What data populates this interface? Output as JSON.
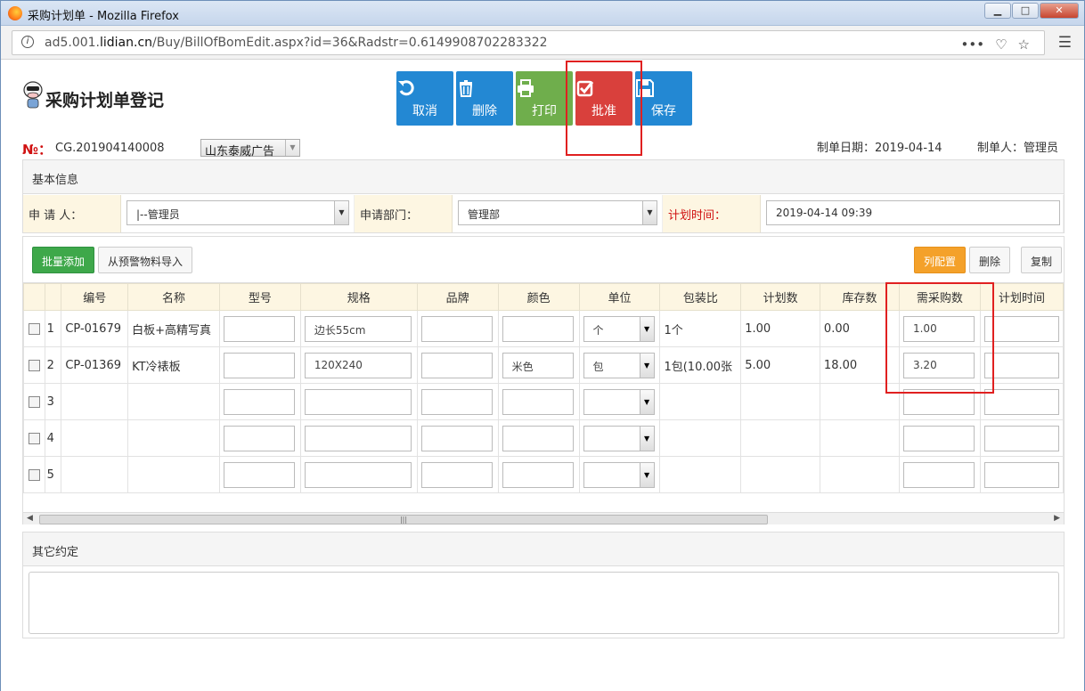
{
  "window": {
    "title": "采购计划单 - Mozilla Firefox",
    "min": "▁",
    "max": "□",
    "close": "✕"
  },
  "browser": {
    "url_host": "ad5.001.lidian.cn",
    "url_path": "/Buy/BillOfBomEdit.aspx?id=36&Radstr=0.6149908702283322",
    "url_prefix": "ad5.001."
  },
  "page": {
    "title": "采购计划单登记"
  },
  "toolbar": [
    {
      "label": "取消",
      "icon": "undo-icon",
      "color": "#2388d3"
    },
    {
      "label": "删除",
      "icon": "trash-icon",
      "color": "#2388d3"
    },
    {
      "label": "打印",
      "icon": "printer-icon",
      "color": "#6fae4c"
    },
    {
      "label": "批准",
      "icon": "check-square-icon",
      "color": "#d9403c"
    },
    {
      "label": "保存",
      "icon": "floppy-icon",
      "color": "#2388d3"
    }
  ],
  "header": {
    "no_label": "№：",
    "no_value": "CG.201904140008",
    "company": "山东泰威广告",
    "date": "制单日期：2019-04-14",
    "maker": "制单人：管理员"
  },
  "basic": {
    "title": "基本信息",
    "applicant_label": "申 请 人：",
    "applicant_value": "|--管理员",
    "dept_label": "申请部门：",
    "dept_value": "管理部",
    "time_label": "计划时间：",
    "time_value": "2019-04-14 09:39"
  },
  "detail": {
    "btn_batch_add": "批量添加",
    "btn_import": "从预警物料导入",
    "btn_columns": "列配置",
    "btn_delete": "删除",
    "btn_copy": "复制",
    "columns": [
      "编号",
      "名称",
      "型号",
      "规格",
      "品牌",
      "颜色",
      "单位",
      "包装比",
      "计划数",
      "库存数",
      "需采购数",
      "计划时间"
    ],
    "rows": [
      {
        "n": "1",
        "code": "CP-01679",
        "name": "白板+高精写真",
        "model": "",
        "spec": "边长55cm",
        "brand": "",
        "color": "",
        "unit": "个",
        "pack": "1个",
        "plan": "1.00",
        "stock": "0.00",
        "need": "1.00"
      },
      {
        "n": "2",
        "code": "CP-01369",
        "name": "KT冷裱板",
        "model": "",
        "spec": "120X240",
        "brand": "",
        "color": "米色",
        "unit": "包",
        "pack": "1包(10.00张",
        "plan": "5.00",
        "stock": "18.00",
        "need": "3.20"
      },
      {
        "n": "3",
        "code": "",
        "name": "",
        "model": "",
        "spec": "",
        "brand": "",
        "color": "",
        "unit": "",
        "pack": "",
        "plan": "",
        "stock": "",
        "need": ""
      },
      {
        "n": "4",
        "code": "",
        "name": "",
        "model": "",
        "spec": "",
        "brand": "",
        "color": "",
        "unit": "",
        "pack": "",
        "plan": "",
        "stock": "",
        "need": ""
      },
      {
        "n": "5",
        "code": "",
        "name": "",
        "model": "",
        "spec": "",
        "brand": "",
        "color": "",
        "unit": "",
        "pack": "",
        "plan": "",
        "stock": "",
        "need": ""
      }
    ]
  },
  "other": {
    "title": "其它约定"
  }
}
